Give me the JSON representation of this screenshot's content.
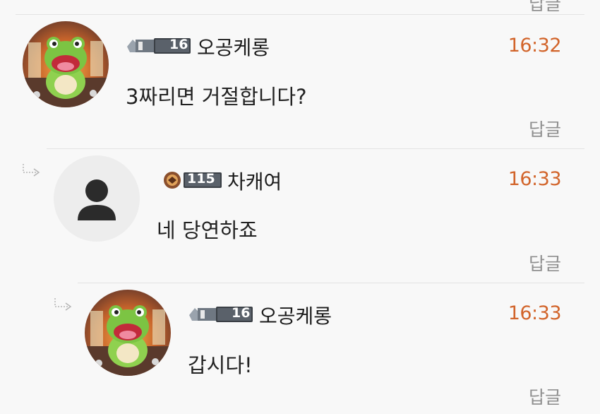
{
  "top_reply_label": "답글",
  "comments": [
    {
      "nickname": "오공케롱",
      "level": "16",
      "time": "16:32",
      "text": "3짜리면 거절합니다?",
      "reply_label": "답글"
    },
    {
      "nickname": "차캐여",
      "level": "115",
      "time": "16:33",
      "text": "네 당연하죠",
      "reply_label": "답글"
    },
    {
      "nickname": "오공케롱",
      "level": "16",
      "time": "16:33",
      "text": "갑시다!",
      "reply_label": "답글"
    }
  ],
  "colors": {
    "time": "#d2642a",
    "reply": "#8f8f8f",
    "divider": "#e3e3e3",
    "default_avatar_bg": "#ededed",
    "default_avatar_icon": "#2b2b2b"
  }
}
